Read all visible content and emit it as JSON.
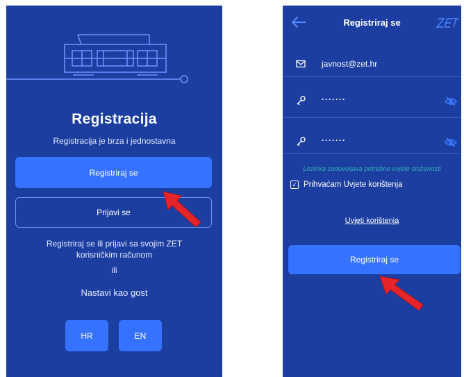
{
  "left": {
    "title": "Registracija",
    "subtitle": "Registracija je brza i jednostavna",
    "register_label": "Registriraj se",
    "login_label": "Prijavi se",
    "info_line1": "Registriraj se ili prijavi sa svojim ZET",
    "info_line2": "korisničkim računom",
    "or": "ili",
    "guest_label": "Nastavi kao gost",
    "languages": [
      "HR",
      "EN"
    ]
  },
  "right": {
    "header_title": "Registriraj se",
    "logo_text": "ZET",
    "email_value": "javnost@zet.hr",
    "password_value": "·······",
    "password_confirm_value": "·······",
    "password_hint": "Lozinka zadovoljava potrebne uvjete složenosti",
    "accept_terms_label": "Prihvaćam Uvjete korištenja",
    "accept_terms_checked": true,
    "terms_link": "Uvjeti korištenja",
    "register_label": "Registriraj se"
  },
  "colors": {
    "background": "#1b3ea0",
    "button": "#3472ff",
    "outline": "#6d8fff",
    "hint": "#34b1b8",
    "arrow": "#e5252a"
  },
  "icons": {
    "email": "envelope-icon",
    "password": "key-icon",
    "visibility": "eye-off-icon",
    "back": "arrow-left-icon"
  }
}
